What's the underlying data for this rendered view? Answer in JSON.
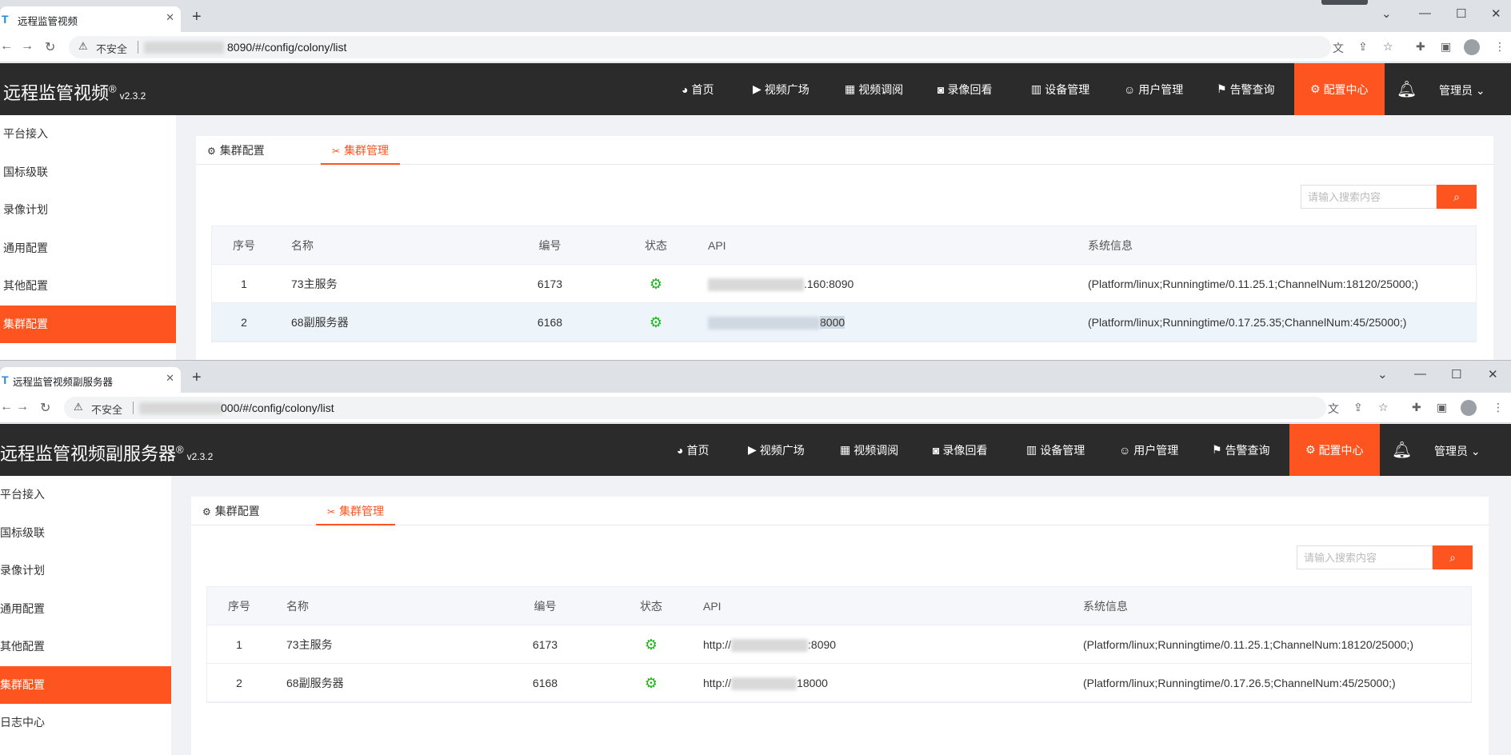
{
  "window1": {
    "tab_title": "远程监管视频",
    "tab_favicon": "T",
    "url_security": "不安全",
    "url_tail": "8090/#/config/colony/list",
    "app": {
      "title": "远程监管视频",
      "reg": "®",
      "version": "v2.3.2"
    },
    "sidebar": [
      "平台接入",
      "国标级联",
      "录像计划",
      "通用配置",
      "其他配置",
      "集群配置"
    ],
    "active_sidebar_index": 5,
    "table_rows": [
      {
        "no": "1",
        "name": "73主服务",
        "code": "6173",
        "api_prefix": "",
        "api_suffix": ".160:8090",
        "info": "(Platform/linux;Runningtime/0.11.25.1;ChannelNum:18120/25000;)"
      },
      {
        "no": "2",
        "name": "68副服务器",
        "code": "6168",
        "api_prefix": "",
        "api_suffix": "8000",
        "info": "(Platform/linux;Runningtime/0.17.25.35;ChannelNum:45/25000;)"
      }
    ]
  },
  "window2": {
    "tab_title": "远程监管视频副服务器",
    "tab_favicon": "T",
    "url_security": "不安全",
    "url_tail": "000/#/config/colony/list",
    "app": {
      "title": "远程监管视频副服务器",
      "reg": "®",
      "version": "v2.3.2"
    },
    "sidebar": [
      "平台接入",
      "国标级联",
      "录像计划",
      "通用配置",
      "其他配置",
      "集群配置",
      "日志中心"
    ],
    "active_sidebar_index": 5,
    "table_rows": [
      {
        "no": "1",
        "name": "73主服务",
        "code": "6173",
        "api_prefix": "http://",
        "api_suffix": ":8090",
        "info": "(Platform/linux;Runningtime/0.11.25.1;ChannelNum:18120/25000;)"
      },
      {
        "no": "2",
        "name": "68副服务器",
        "code": "6168",
        "api_prefix": "http://",
        "api_suffix": "18000",
        "info": "(Platform/linux;Runningtime/0.17.26.5;ChannelNum:45/25000;)"
      }
    ]
  },
  "menu": [
    "首页",
    "视频广场",
    "视频调阅",
    "录像回看",
    "设备管理",
    "用户管理",
    "告警查询",
    "配置中心"
  ],
  "menu_icons": [
    "dashboard-icon",
    "play-icon",
    "grid-icon",
    "video-camera-icon",
    "barcode-icon",
    "user-icon",
    "alarm-icon",
    "gear-icon"
  ],
  "admin_label": "管理员",
  "tabs": {
    "cluster_config": "集群配置",
    "cluster_manage": "集群管理"
  },
  "search": {
    "placeholder": "请输入搜索内容"
  },
  "columns": {
    "no": "序号",
    "name": "名称",
    "code": "编号",
    "status": "状态",
    "api": "API",
    "info": "系统信息"
  },
  "colors": {
    "accent": "#fd5420",
    "header_bg": "#2b2b2b",
    "status_ok": "#1bb51b"
  }
}
